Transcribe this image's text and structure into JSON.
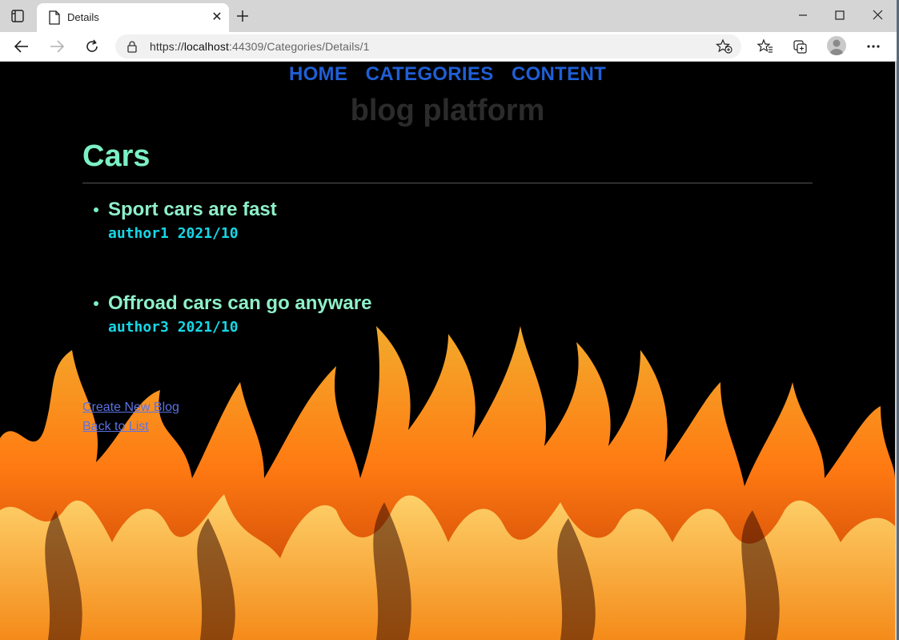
{
  "browser": {
    "tab_title": "Details",
    "url_prefix": "https://",
    "url_host": "localhost",
    "url_rest": ":44309/Categories/Details/1"
  },
  "nav": [
    "HOME",
    "CATEGORIES",
    "CONTENT"
  ],
  "brand": "blog platform",
  "page": {
    "heading": "Cars",
    "posts": [
      {
        "title": "Sport cars are fast",
        "author": "author1",
        "date": "2021/10"
      },
      {
        "title": "Offroad cars can go anyware",
        "author": "author3",
        "date": "2021/10"
      }
    ],
    "links": {
      "create": "Create New Blog",
      "back": "Back to List"
    }
  },
  "icons": [
    "tab-actions-icon",
    "page-icon",
    "close-icon",
    "plus-icon",
    "minimize-icon",
    "maximize-icon",
    "close-window-icon",
    "back-arrow-icon",
    "forward-arrow-icon",
    "refresh-icon",
    "lock-icon",
    "favorite-add-icon",
    "favorites-icon",
    "collections-icon",
    "profile-icon",
    "more-icon"
  ],
  "colors": {
    "nav_link": "#1f5fd6",
    "heading": "#7cf0c5",
    "post_meta": "#16d7e6",
    "link": "#5b73e6",
    "background": "#000000"
  }
}
